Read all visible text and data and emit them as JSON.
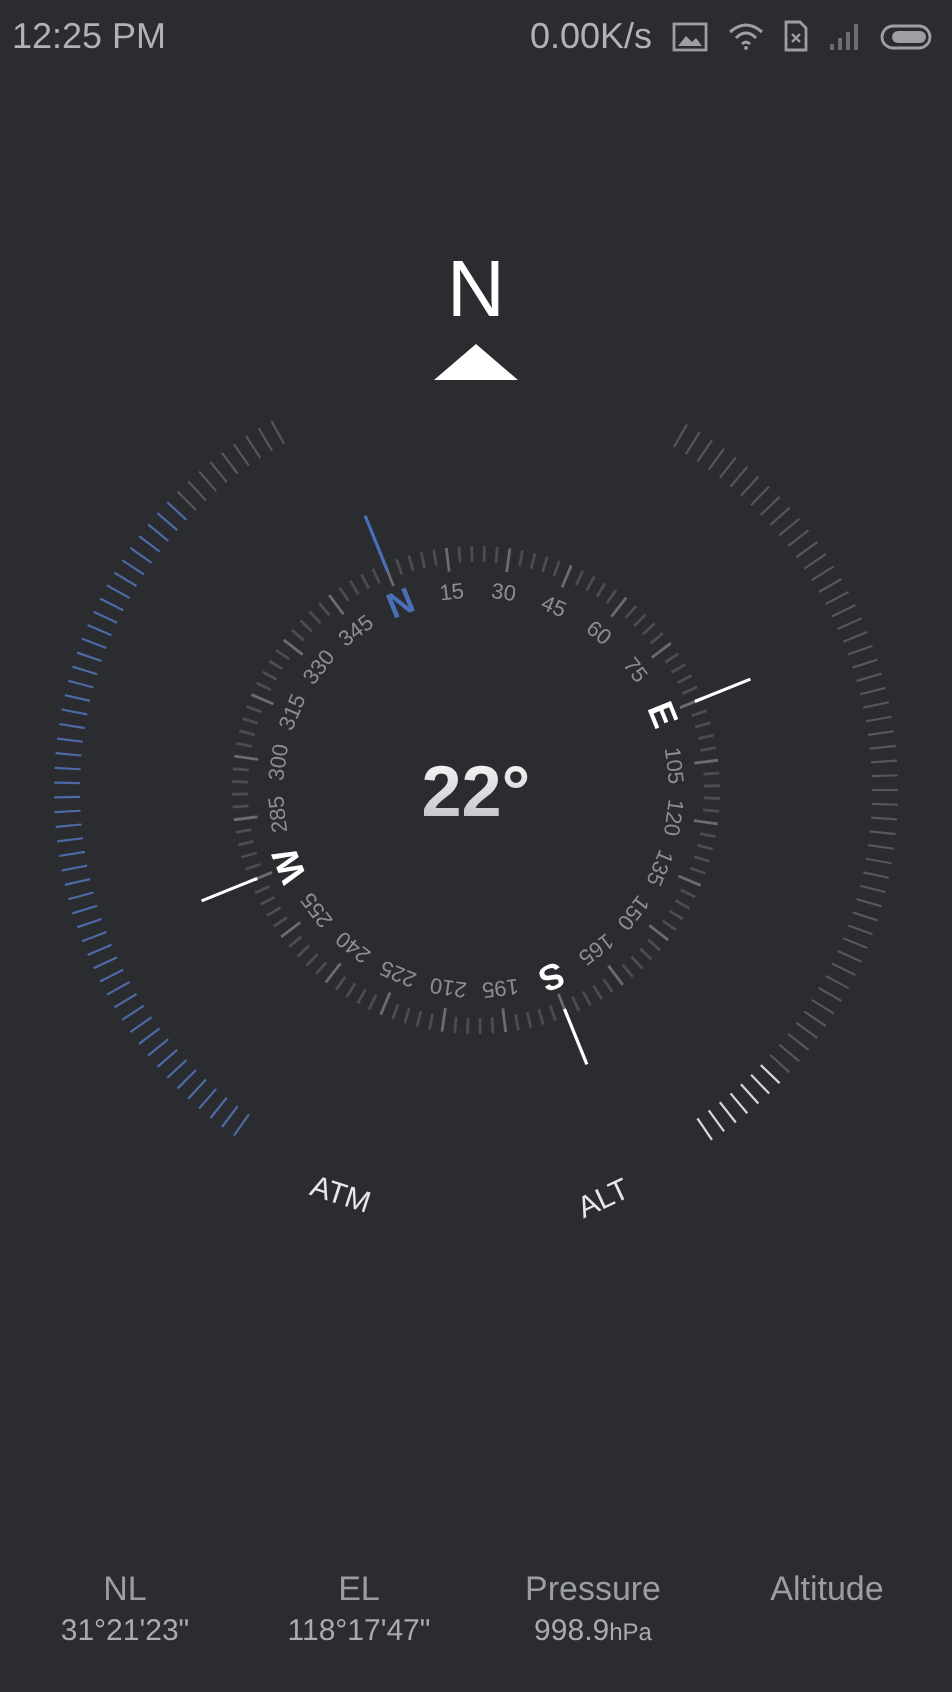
{
  "status_bar": {
    "time": "12:25 PM",
    "speed": "0.00K/s"
  },
  "compass": {
    "north_label": "N",
    "heading": "22°",
    "dial": [
      {
        "label": "N",
        "kind": "cardinal",
        "color": "#4a6fb8"
      },
      {
        "label": "15",
        "kind": "number",
        "color": "#8c8e91"
      },
      {
        "label": "30",
        "kind": "number",
        "color": "#8c8e91"
      },
      {
        "label": "45",
        "kind": "number",
        "color": "#8c8e91"
      },
      {
        "label": "60",
        "kind": "number",
        "color": "#8c8e91"
      },
      {
        "label": "75",
        "kind": "number",
        "color": "#8c8e91"
      },
      {
        "label": "E",
        "kind": "cardinal",
        "color": "#ffffff"
      },
      {
        "label": "105",
        "kind": "number",
        "color": "#8c8e91"
      },
      {
        "label": "120",
        "kind": "number",
        "color": "#8c8e91"
      },
      {
        "label": "135",
        "kind": "number",
        "color": "#8c8e91"
      },
      {
        "label": "150",
        "kind": "number",
        "color": "#8c8e91"
      },
      {
        "label": "165",
        "kind": "number",
        "color": "#8c8e91"
      },
      {
        "label": "S",
        "kind": "cardinal",
        "color": "#ffffff"
      },
      {
        "label": "195",
        "kind": "number",
        "color": "#8c8e91"
      },
      {
        "label": "210",
        "kind": "number",
        "color": "#8c8e91"
      },
      {
        "label": "225",
        "kind": "number",
        "color": "#8c8e91"
      },
      {
        "label": "240",
        "kind": "number",
        "color": "#8c8e91"
      },
      {
        "label": "255",
        "kind": "number",
        "color": "#8c8e91"
      },
      {
        "label": "W",
        "kind": "cardinal",
        "color": "#ffffff"
      },
      {
        "label": "285",
        "kind": "number",
        "color": "#8c8e91"
      },
      {
        "label": "300",
        "kind": "number",
        "color": "#8c8e91"
      },
      {
        "label": "315",
        "kind": "number",
        "color": "#8c8e91"
      },
      {
        "label": "330",
        "kind": "number",
        "color": "#8c8e91"
      },
      {
        "label": "345",
        "kind": "number",
        "color": "#8c8e91"
      }
    ],
    "gauges": [
      {
        "label": "ATM"
      },
      {
        "label": "ALT"
      }
    ]
  },
  "stats": [
    {
      "label": "NL",
      "value": "31°21'23\""
    },
    {
      "label": "EL",
      "value": "118°17'47\""
    },
    {
      "label": "Pressure",
      "value": "998.9",
      "unit": "hPa"
    },
    {
      "label": "Altitude"
    }
  ]
}
